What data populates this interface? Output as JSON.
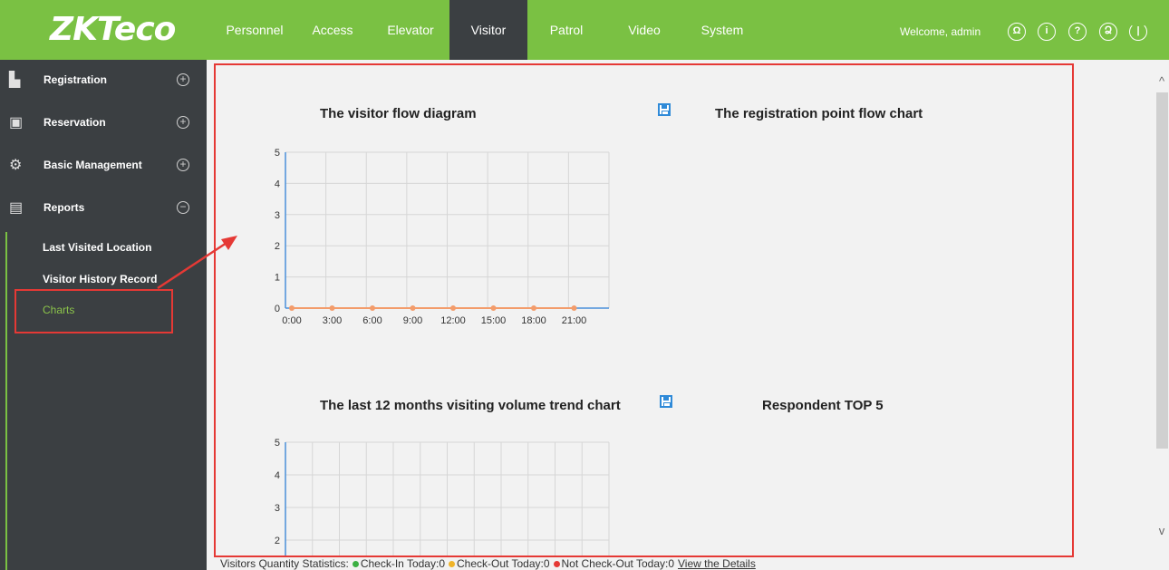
{
  "header": {
    "logo": "ZKTeco",
    "nav": [
      {
        "label": "Personnel"
      },
      {
        "label": "Access"
      },
      {
        "label": "Elevator"
      },
      {
        "label": "Visitor",
        "active": true
      },
      {
        "label": "Patrol"
      },
      {
        "label": "Video"
      },
      {
        "label": "System"
      }
    ],
    "welcome": "Welcome, admin",
    "icons": [
      "user-icon",
      "info-icon",
      "help-icon",
      "account-icon",
      "power-icon"
    ]
  },
  "sidebar": {
    "menus": [
      {
        "label": "Registration",
        "icon": "registration-icon",
        "expanded": false
      },
      {
        "label": "Reservation",
        "icon": "reservation-icon",
        "expanded": false
      },
      {
        "label": "Basic Management",
        "icon": "settings-gears-icon",
        "expanded": false
      },
      {
        "label": "Reports",
        "icon": "report-icon",
        "expanded": true
      }
    ],
    "report_items": [
      {
        "label": "Last Visited Location"
      },
      {
        "label": "Visitor History Record"
      },
      {
        "label": "Charts",
        "active": true
      }
    ]
  },
  "charts": {
    "flow_title": "The visitor flow diagram",
    "registration_title": "The registration point flow chart",
    "trend_title": "The last 12 months visiting volume trend chart",
    "respondent_title": "Respondent TOP 5"
  },
  "chart_data": [
    {
      "type": "line",
      "title": "The visitor flow diagram",
      "categories": [
        "0:00",
        "3:00",
        "6:00",
        "9:00",
        "12:00",
        "15:00",
        "18:00",
        "21:00"
      ],
      "series": [
        {
          "values": [
            0,
            0,
            0,
            0,
            0,
            0,
            0,
            0
          ]
        }
      ],
      "ylim": [
        0,
        5
      ],
      "yticks": [
        0,
        1,
        2,
        3,
        4,
        5
      ],
      "grid": true
    },
    {
      "type": "line",
      "title": "The last 12 months visiting volume trend chart",
      "yticks": [
        2,
        3,
        4,
        5
      ],
      "grid": true
    }
  ],
  "footer": {
    "prefix": "Visitors Quantity Statistics:",
    "checkin": "Check-In Today:0",
    "checkout": "Check-Out Today:0",
    "not_checkout": "Not Check-Out Today:0",
    "link": "View the Details"
  },
  "colors": {
    "brand_green": "#7ac143",
    "sidebar_dark": "#3b3f42",
    "highlight_red": "#e53935",
    "axis_blue": "#4a90d9",
    "point_orange": "#f39c6b"
  }
}
